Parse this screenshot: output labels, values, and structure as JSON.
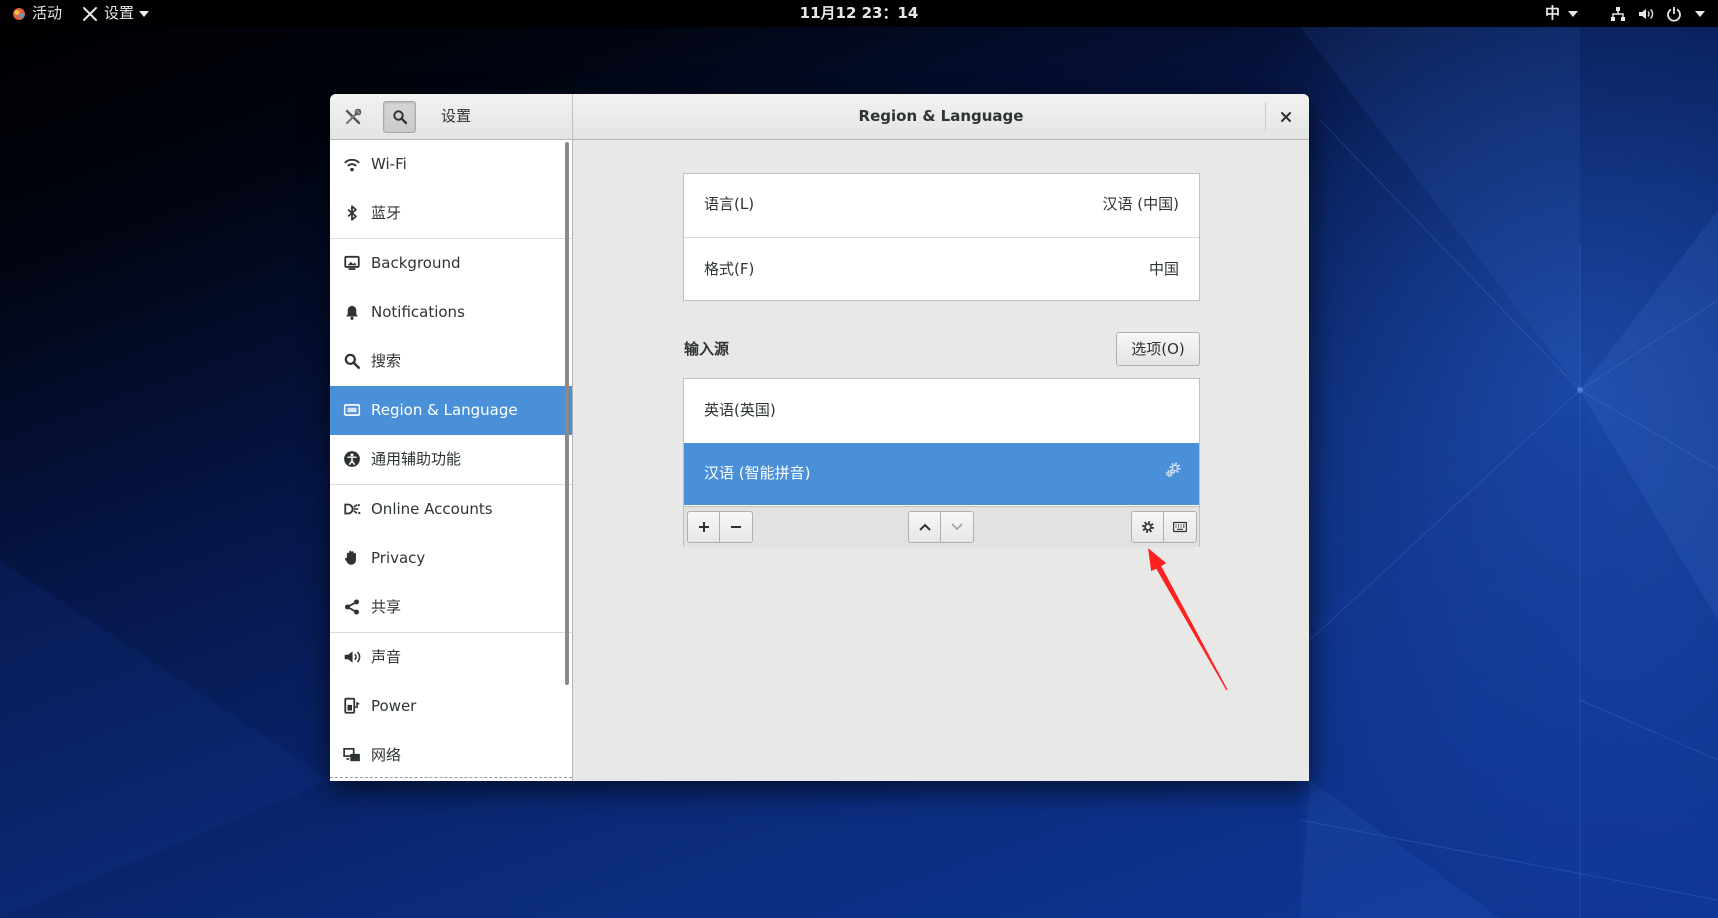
{
  "topbar": {
    "activities": "活动",
    "app_menu": "设置",
    "clock": "11月12 23：14",
    "input_method": "中",
    "icons": [
      "activities-icon",
      "tools-icon",
      "caret-down-icon",
      "network-wired-icon",
      "volume-icon",
      "power-icon"
    ]
  },
  "window": {
    "app_title": "设置",
    "page_title": "Region & Language"
  },
  "sidebar": {
    "items": [
      {
        "label": "Wi-Fi",
        "icon": "wifi-icon"
      },
      {
        "label": "蓝牙",
        "icon": "bluetooth-icon"
      },
      {
        "label": "Background",
        "icon": "background-icon"
      },
      {
        "label": "Notifications",
        "icon": "bell-icon"
      },
      {
        "label": "搜索",
        "icon": "search-icon"
      },
      {
        "label": "Region & Language",
        "icon": "region-icon",
        "selected": true
      },
      {
        "label": "通用辅助功能",
        "icon": "accessibility-icon"
      },
      {
        "label": "Online Accounts",
        "icon": "online-accounts-icon"
      },
      {
        "label": "Privacy",
        "icon": "privacy-hand-icon"
      },
      {
        "label": "共享",
        "icon": "share-icon"
      },
      {
        "label": "声音",
        "icon": "speaker-icon"
      },
      {
        "label": "Power",
        "icon": "power-icon"
      },
      {
        "label": "网络",
        "icon": "network-icon"
      }
    ]
  },
  "region": {
    "rows": [
      {
        "label": "语言(L)",
        "value": "汉语 (中国)"
      },
      {
        "label": "格式(F)",
        "value": "中国"
      }
    ]
  },
  "input_sources": {
    "title": "输入源",
    "options_button": "选项(O)",
    "items": [
      {
        "label": "英语(英国)"
      },
      {
        "label": "汉语 (智能拼音)",
        "selected": true,
        "icon": "input-settings-icon"
      }
    ],
    "toolbar_icons": [
      "add-icon",
      "remove-icon",
      "move-up-icon",
      "move-down-icon",
      "settings-gear-icon",
      "keyboard-layout-icon"
    ]
  },
  "colors": {
    "accent": "#4a90d9",
    "topbar": "#000000",
    "annotation_arrow": "#ff2020",
    "desktop": "#0d3189"
  }
}
